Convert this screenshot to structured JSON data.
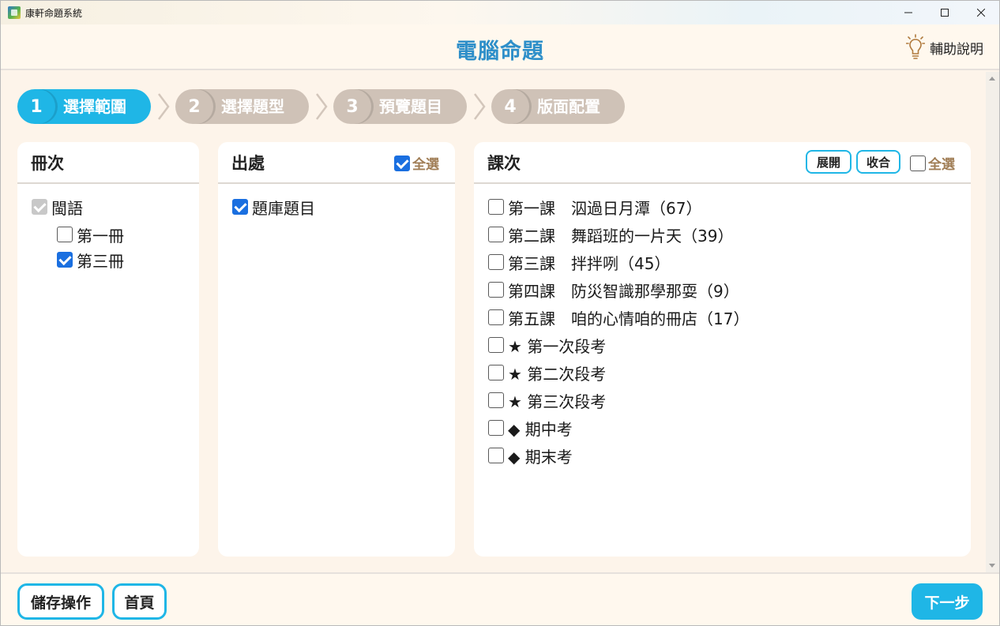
{
  "window": {
    "app_title": "康軒命題系統",
    "icons": {
      "app": "app-logo-icon",
      "minimize": "minimize-icon",
      "maximize": "maximize-icon",
      "close": "close-icon"
    }
  },
  "header": {
    "title": "電腦命題",
    "help_label": "輔助說明",
    "help_icon": "lightbulb-icon",
    "title_color": "#2e8fc9"
  },
  "steps": [
    {
      "num": "1",
      "label": "選擇範圍",
      "active": true
    },
    {
      "num": "2",
      "label": "選擇題型",
      "active": false
    },
    {
      "num": "3",
      "label": "預覽題目",
      "active": false
    },
    {
      "num": "4",
      "label": "版面配置",
      "active": false
    }
  ],
  "accent_color": "#1fb6e6",
  "panels": {
    "volume": {
      "title": "冊次",
      "subject": {
        "label": "閩語",
        "checked": true,
        "disabled": true
      },
      "items": [
        {
          "label": "第一冊",
          "checked": false
        },
        {
          "label": "第三冊",
          "checked": true
        }
      ]
    },
    "source": {
      "title": "出處",
      "select_all": {
        "label": "全選",
        "checked": true
      },
      "items": [
        {
          "label": "題庫題目",
          "checked": true
        }
      ]
    },
    "lesson": {
      "title": "課次",
      "expand_label": "展開",
      "collapse_label": "收合",
      "select_all": {
        "label": "全選",
        "checked": false
      },
      "items": [
        {
          "label": "第一課　泅過日月潭（67）",
          "checked": false
        },
        {
          "label": "第二課　舞蹈班的一片天（39）",
          "checked": false
        },
        {
          "label": "第三課　拌拌咧（45）",
          "checked": false
        },
        {
          "label": "第四課　防災智識那學那耍（9）",
          "checked": false
        },
        {
          "label": "第五課　咱的心情咱的冊店（17）",
          "checked": false
        },
        {
          "label": "★ 第一次段考",
          "checked": false
        },
        {
          "label": "★ 第二次段考",
          "checked": false
        },
        {
          "label": "★ 第三次段考",
          "checked": false
        },
        {
          "label": "◆ 期中考",
          "checked": false
        },
        {
          "label": "◆ 期末考",
          "checked": false
        }
      ]
    }
  },
  "footer": {
    "save_label": "儲存操作",
    "home_label": "首頁",
    "next_label": "下一步"
  }
}
